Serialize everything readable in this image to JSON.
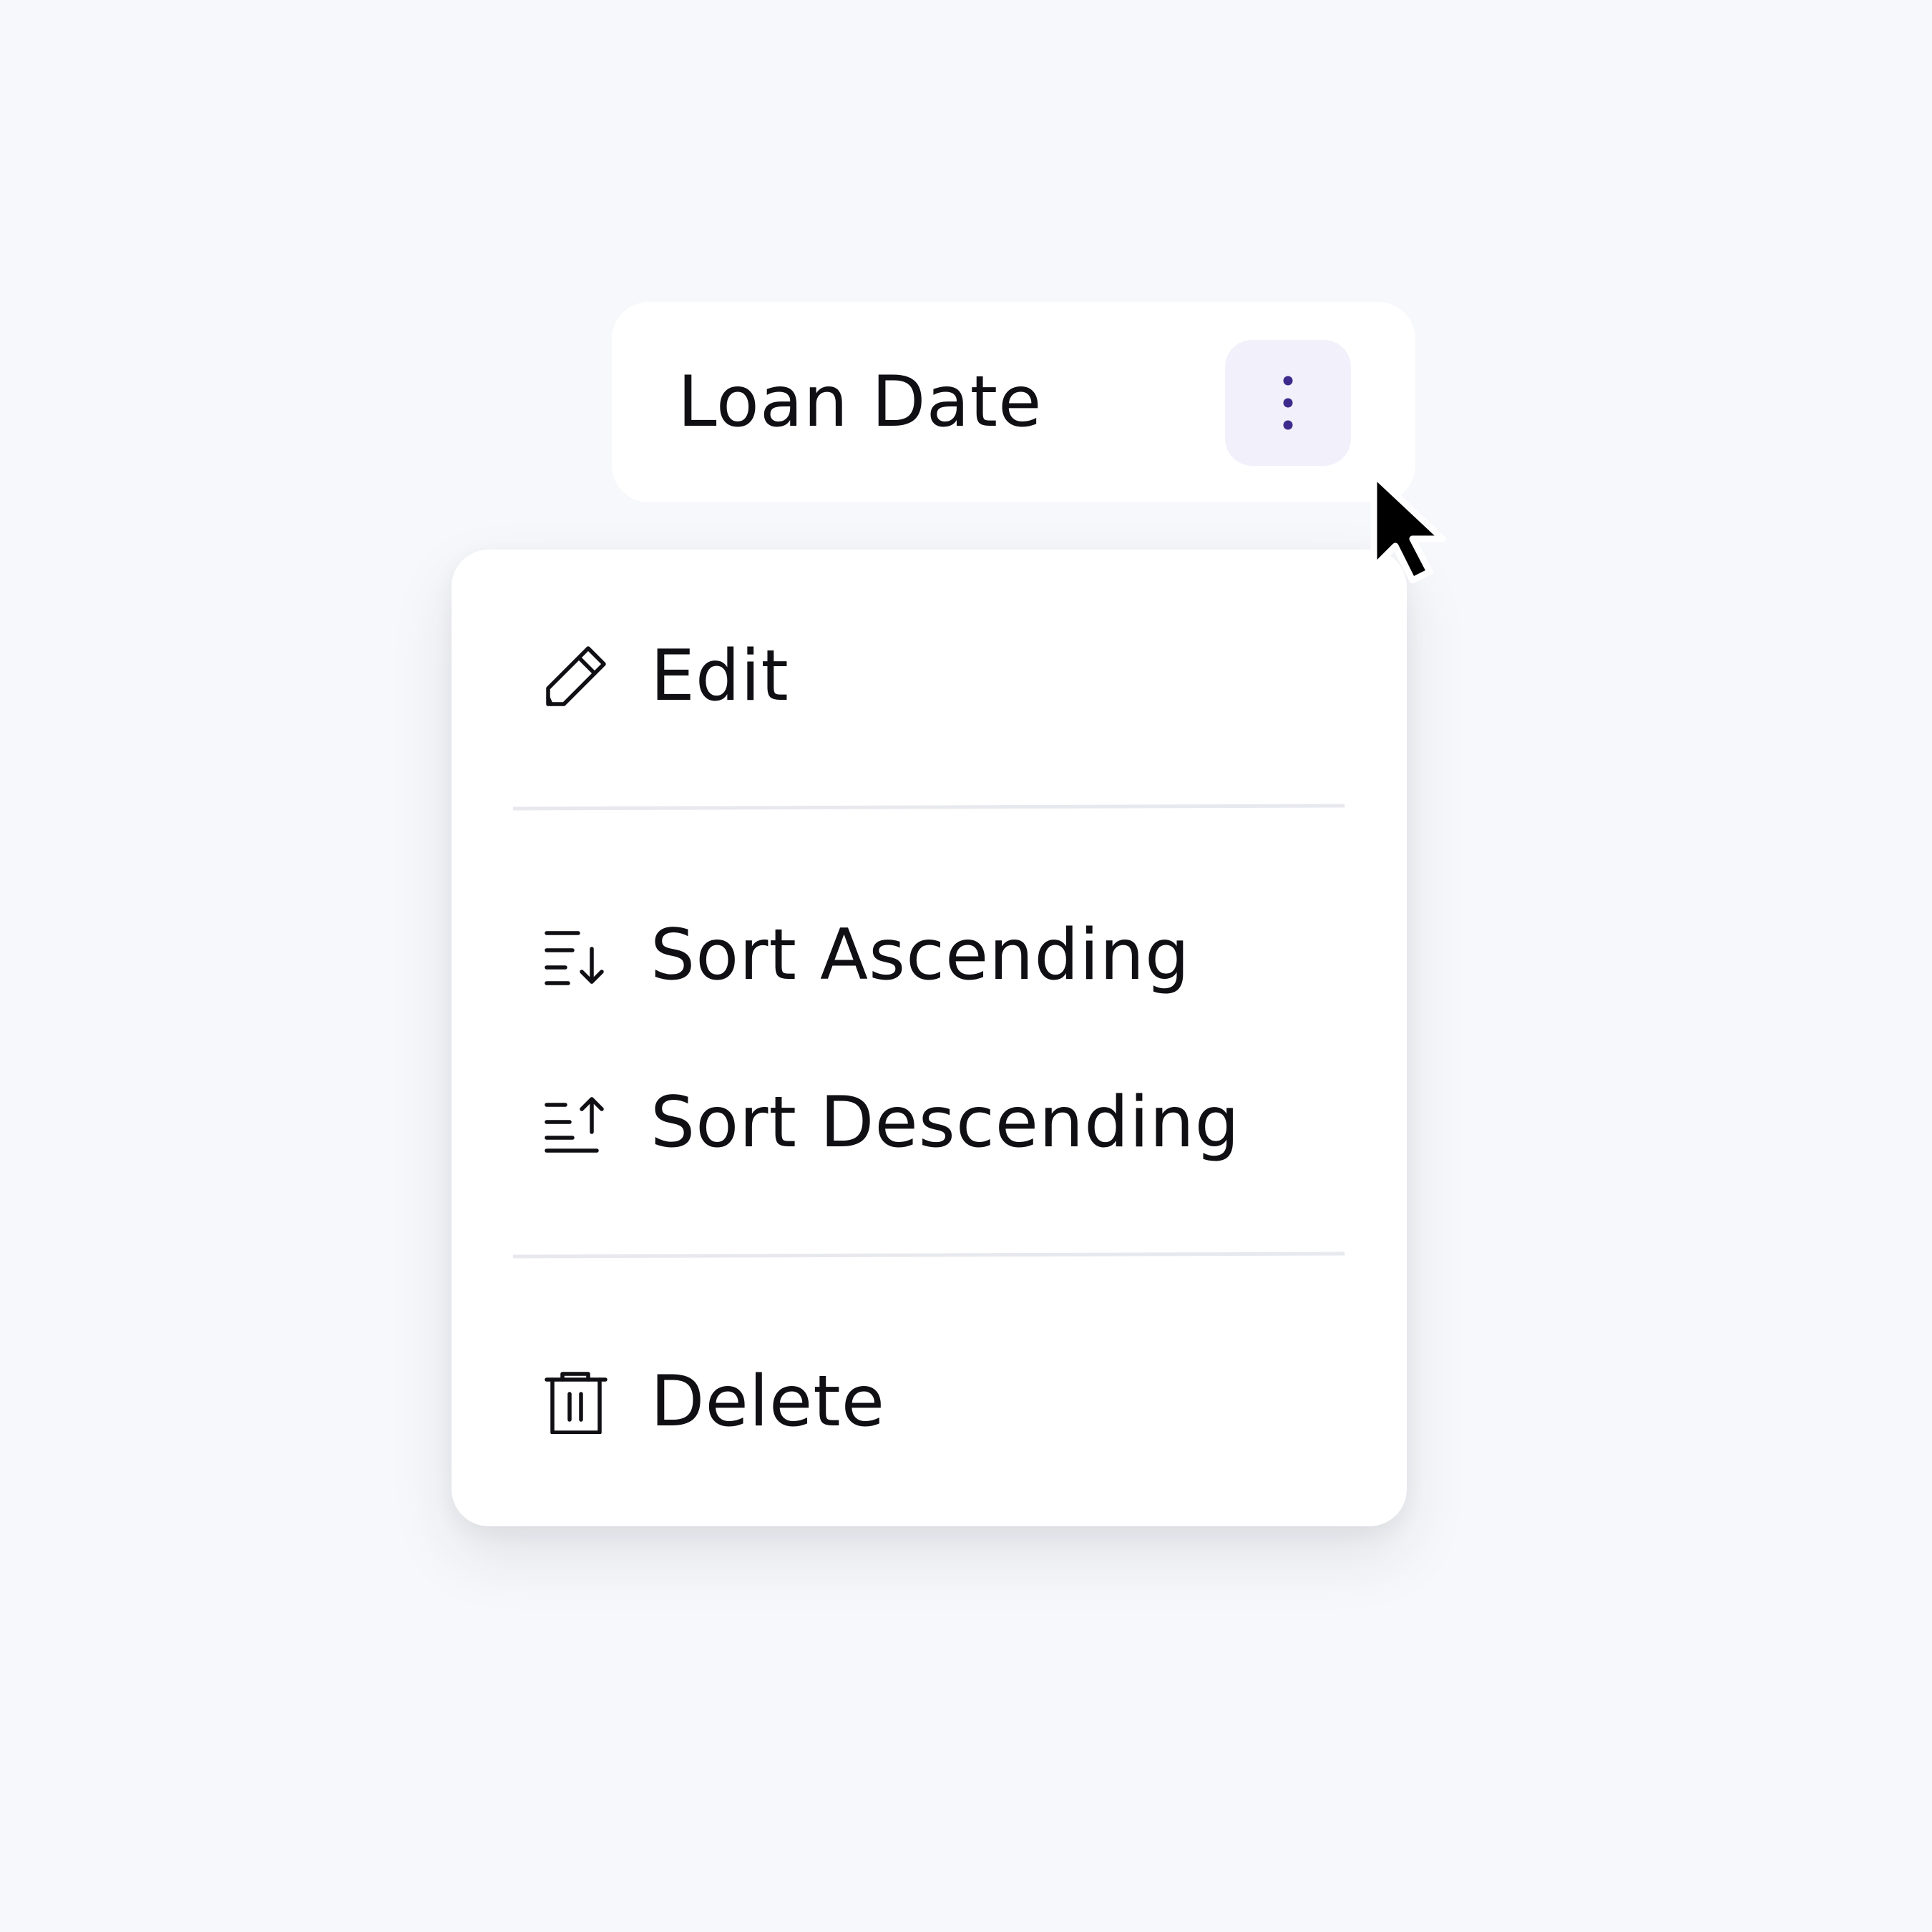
{
  "column_header": {
    "title": "Loan Date",
    "menu_button_icon": "more-vertical-icon",
    "accent_color": "#3d2a8c"
  },
  "menu": {
    "items": [
      {
        "label": "Edit",
        "icon": "pencil-icon"
      },
      {
        "label": "Sort Ascending",
        "icon": "sort-ascending-icon"
      },
      {
        "label": "Sort Descending",
        "icon": "sort-descending-icon"
      },
      {
        "label": "Delete",
        "icon": "trash-icon"
      }
    ]
  },
  "pointer": {
    "icon": "mouse-pointer-icon"
  }
}
